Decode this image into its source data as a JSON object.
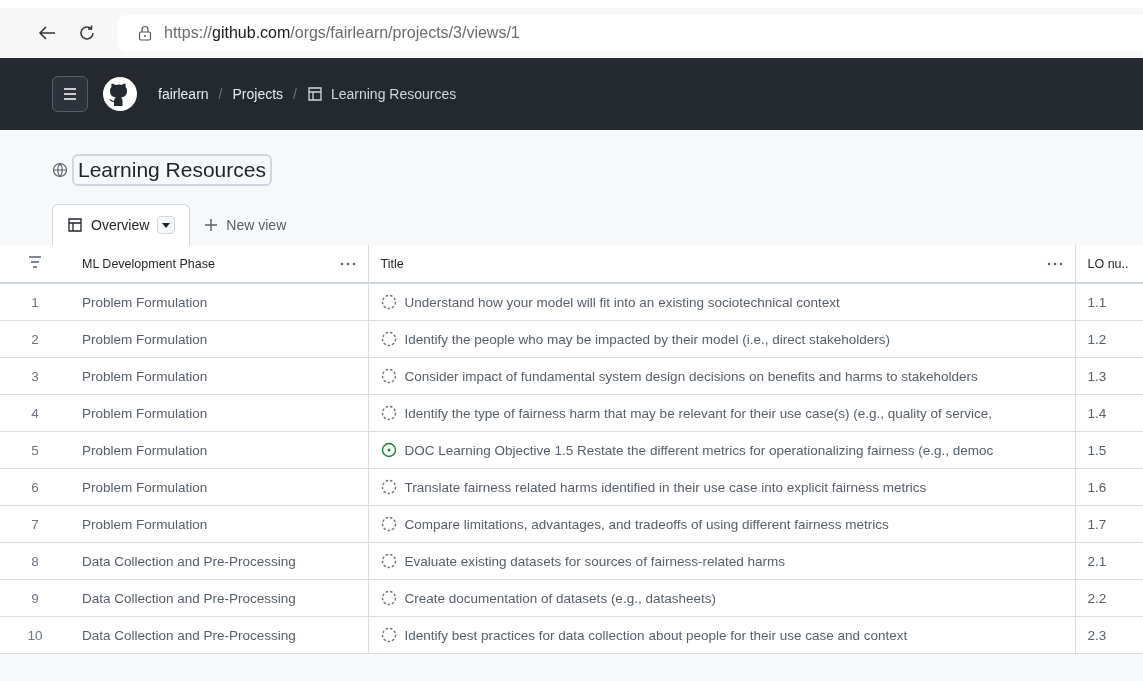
{
  "browser": {
    "url": {
      "scheme": "https://",
      "domain": "github.com",
      "path": "/orgs/fairlearn/projects/3/views/1"
    }
  },
  "header": {
    "breadcrumbs": [
      {
        "kind": "link",
        "label": "fairlearn"
      },
      {
        "kind": "separator",
        "label": "/"
      },
      {
        "kind": "link",
        "label": "Projects"
      },
      {
        "kind": "separator",
        "label": "/"
      },
      {
        "kind": "current",
        "label": "Learning Resources"
      }
    ]
  },
  "project": {
    "title": "Learning Resources"
  },
  "tabs": [
    {
      "label": "Overview",
      "selected": true
    },
    {
      "label": "New view",
      "selected": false
    }
  ],
  "table": {
    "columns": [
      "ML Development Phase",
      "Title",
      "LO nu.."
    ],
    "rows": [
      {
        "number": "1",
        "phase": "Problem Formulation",
        "kind": "draft",
        "title": "Understand how your model will fit into an existing sociotechnical context",
        "lo": "1.1"
      },
      {
        "number": "2",
        "phase": "Problem Formulation",
        "kind": "draft",
        "title": "Identify the people who may be impacted by their model (i.e., direct stakeholders)",
        "lo": "1.2"
      },
      {
        "number": "3",
        "phase": "Problem Formulation",
        "kind": "draft",
        "title": "Consider impact of fundamental system design decisions on benefits and harms to stakeholders",
        "lo": "1.3"
      },
      {
        "number": "4",
        "phase": "Problem Formulation",
        "kind": "draft",
        "title": "Identify the type of fairness harm that may be relevant for their use case(s) (e.g., quality of service,",
        "lo": "1.4"
      },
      {
        "number": "5",
        "phase": "Problem Formulation",
        "kind": "open",
        "title": "DOC Learning Objective 1.5 Restate the different metrics for operationalizing fairness (e.g., democ",
        "lo": "1.5"
      },
      {
        "number": "6",
        "phase": "Problem Formulation",
        "kind": "draft",
        "title": "Translate fairness related harms identified in their use case into explicit fairness metrics",
        "lo": "1.6"
      },
      {
        "number": "7",
        "phase": "Problem Formulation",
        "kind": "draft",
        "title": "Compare limitations, advantages, and tradeoffs of using different fairness metrics",
        "lo": "1.7"
      },
      {
        "number": "8",
        "phase": "Data Collection and Pre-Processing",
        "kind": "draft",
        "title": "Evaluate existing datasets for sources of fairness-related harms",
        "lo": "2.1"
      },
      {
        "number": "9",
        "phase": "Data Collection and Pre-Processing",
        "kind": "draft",
        "title": "Create documentation of datasets (e.g., datasheets)",
        "lo": "2.2"
      },
      {
        "number": "10",
        "phase": "Data Collection and Pre-Processing",
        "kind": "draft",
        "title": "Identify best practices for data collection about people for their use case and context",
        "lo": "2.3"
      }
    ]
  }
}
